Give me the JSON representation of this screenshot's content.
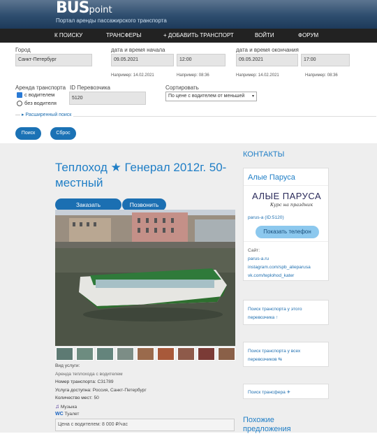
{
  "header": {
    "logo_bus": "BUS",
    "logo_point": "point",
    "tagline": "Портал аренды пассажирского транспорта"
  },
  "nav": [
    "К ПОИСКУ",
    "ТРАНСФЕРЫ",
    "+ ДОБАВИТЬ ТРАНСПОРТ",
    "ВОЙТИ",
    "ФОРУМ"
  ],
  "search": {
    "city_label": "Город",
    "city_value": "Санкт-Петербург",
    "start_label": "дата и время начала",
    "start_date": "09.05.2021",
    "start_time": "12:00",
    "end_label": "дата и время окончания",
    "end_date": "09.05.2021",
    "end_time": "17:00",
    "hint_date": "Например: 14.02.2021",
    "hint_time": "Например: 08:36",
    "rent_label": "Аренда транспорта",
    "with_driver": "с водителем",
    "without_driver": "без водителя",
    "carrier_label": "ID Перевозчика",
    "carrier_value": "5120",
    "sort_label": "Сортировать",
    "sort_value": "По цене с водителем от меньшей",
    "advanced": "Расширенный поиск",
    "search_btn": "Поиск",
    "reset_btn": "Сброс"
  },
  "listing": {
    "title": "Теплоход ★ Генерал 2012г. 50-местный",
    "order_btn": "Заказать",
    "call_btn": "Позвонить",
    "service_type_label": "Вид услуги:",
    "service_type": "Аренда теплохода с водителем",
    "number_label": "Номер транспорта:",
    "number": "С31789",
    "available_label": "Услуга доступна:",
    "available": "Россия, Санкт-Петербург",
    "seats_label": "Количество мест:",
    "seats": "50",
    "feature_music": "Музыка",
    "feature_toilet": "Туалет",
    "price": "Цена с водителем: 8 000 ₽/час"
  },
  "sidebar": {
    "contacts_heading": "КОНТАКТЫ",
    "company": "Алые Паруса",
    "logo_main": "АЛЫЕ ПАРУСА",
    "logo_sub": "Курс на праздник",
    "company_id": "parus-a (ID:5120)",
    "show_phone": "Показать телефон",
    "site_label": "Сайт:",
    "links": [
      "parus-a.ru",
      "instagram.com/spb_alieparusa",
      "vk.com/teplohod_kater"
    ],
    "search_this": "Поиск транспорта у этого перевозчика ↑",
    "search_all": "Поиск транспорта у всех перевозчиков ⇆",
    "search_transfer": "Поиск трансфера ✈",
    "similar_heading": "Похожие предложения"
  },
  "colors": {
    "accent": "#1f7ec6",
    "button": "#1b72b5",
    "nav_bg": "#222222"
  }
}
